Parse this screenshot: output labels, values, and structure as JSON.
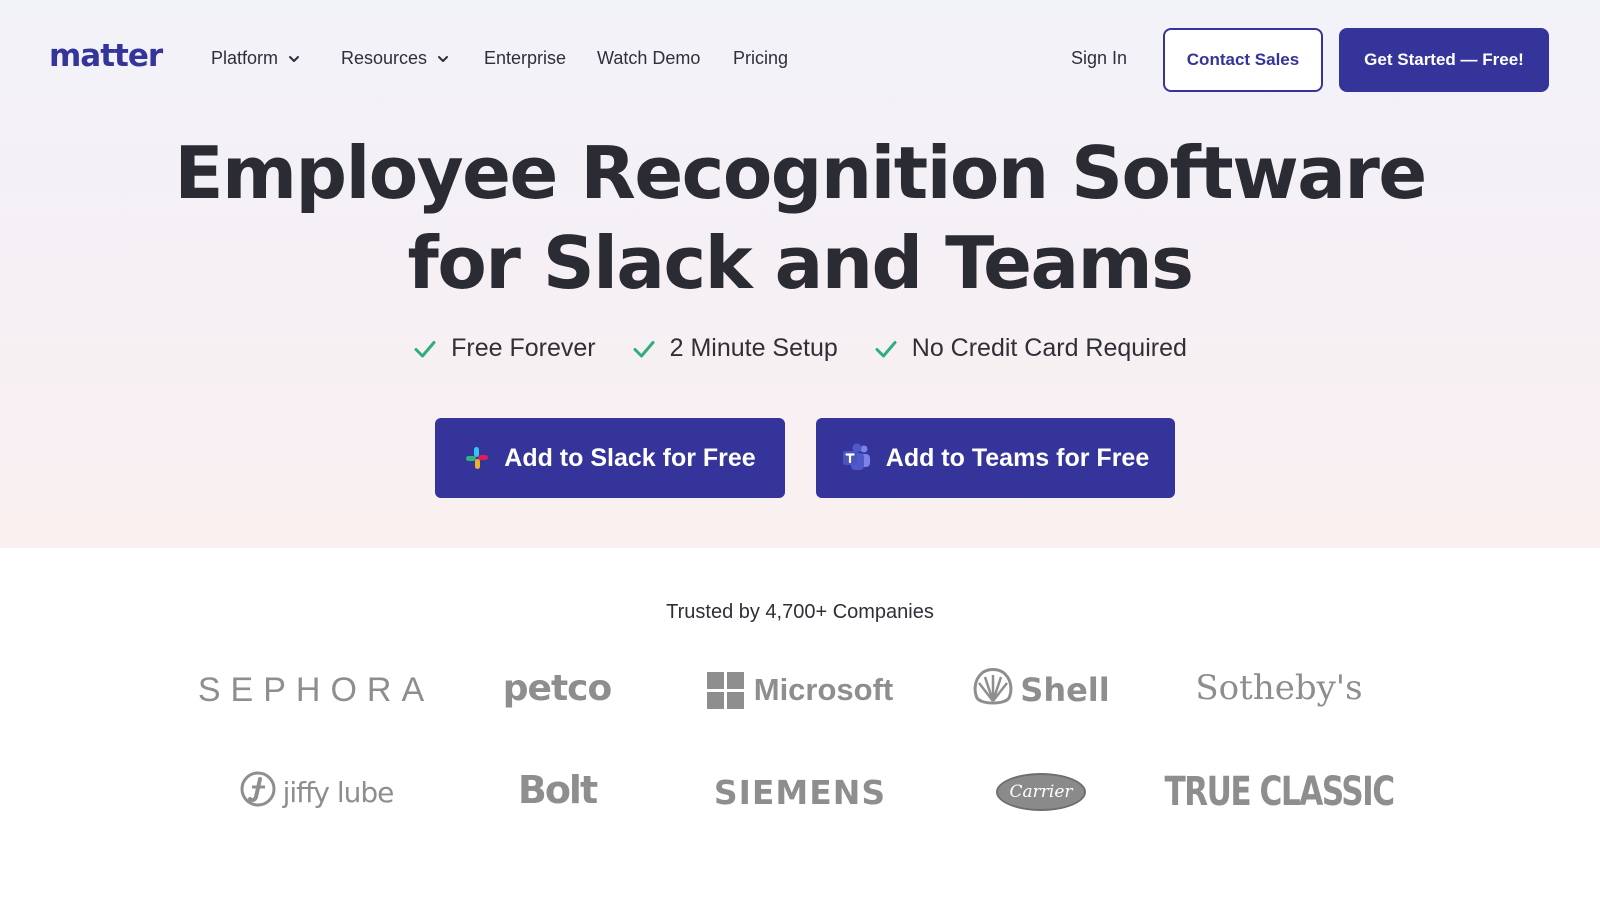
{
  "brand": {
    "logo_text": "matter",
    "accent": "#34349a"
  },
  "nav": {
    "items": [
      {
        "label": "Platform",
        "has_dropdown": true
      },
      {
        "label": "Resources",
        "has_dropdown": true
      },
      {
        "label": "Enterprise",
        "has_dropdown": false
      },
      {
        "label": "Watch Demo",
        "has_dropdown": false
      },
      {
        "label": "Pricing",
        "has_dropdown": false
      }
    ],
    "sign_in": "Sign In",
    "contact_sales": "Contact Sales",
    "get_started": "Get Started — Free!"
  },
  "hero": {
    "headline_line1": "Employee Recognition Software",
    "headline_line2": "for Slack and Teams",
    "features": [
      "Free Forever",
      "2 Minute Setup",
      "No Credit Card Required"
    ],
    "check_color": "#2fae7c",
    "cta_slack": {
      "label": "Add to Slack for Free",
      "icon": "slack-icon"
    },
    "cta_teams": {
      "label": "Add to Teams for Free",
      "icon": "teams-icon"
    }
  },
  "trusted": {
    "label": "Trusted by 4,700+ Companies",
    "logos": [
      "SEPHORA",
      "petco",
      "Microsoft",
      "Shell",
      "Sotheby's",
      "jiffy lube",
      "Bolt",
      "SIEMENS",
      "Carrier",
      "TRUE CLASSIC"
    ],
    "logo_color": "#8e8e8e"
  }
}
